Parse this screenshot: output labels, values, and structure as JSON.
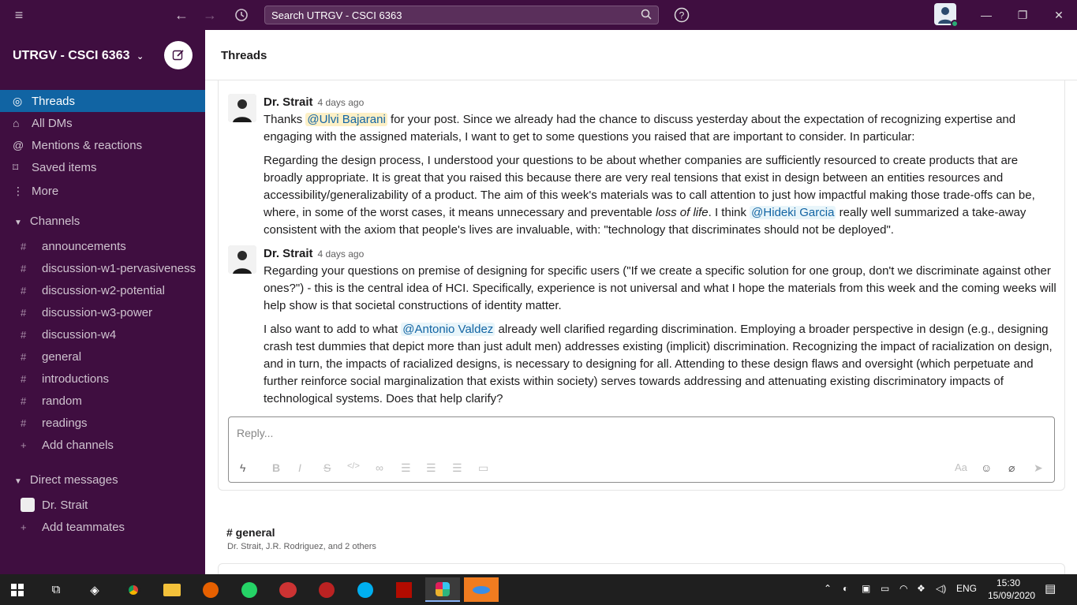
{
  "topbar": {
    "search_placeholder": "Search UTRGV - CSCI 6363",
    "icons": [
      "hamburger-icon",
      "back-icon",
      "forward-icon",
      "history-icon",
      "search-icon",
      "help-icon"
    ]
  },
  "workspace": {
    "name": "UTRGV - CSCI 6363"
  },
  "nav": [
    {
      "label": "Threads",
      "icon": "threads-icon",
      "active": true
    },
    {
      "label": "All DMs",
      "icon": "dms-icon"
    },
    {
      "label": "Mentions & reactions",
      "icon": "at-icon"
    },
    {
      "label": "Saved items",
      "icon": "bookmark-icon"
    },
    {
      "label": "More",
      "icon": "more-icon"
    }
  ],
  "channels_label": "Channels",
  "channels": [
    "announcements",
    "discussion-w1-pervasiveness",
    "discussion-w2-potential",
    "discussion-w3-power",
    "discussion-w4",
    "general",
    "introductions",
    "random",
    "readings"
  ],
  "add_channels": "Add channels",
  "dm_label": "Direct messages",
  "dms": [
    "Dr. Strait"
  ],
  "add_teammates": "Add teammates",
  "header": {
    "title": "Threads"
  },
  "messages": [
    {
      "author": "Dr. Strait",
      "time": "4 days ago",
      "p1_a": "Thanks ",
      "p1_mention": "@Ulvi Bajarani",
      "p1_b": " for your post. Since we already had the chance to discuss yesterday about the expectation of recognizing expertise and engaging with the assigned materials, I want to get to some questions you raised that are important to consider. In particular:",
      "p2_a": "Regarding the design process, I understood your questions to be about whether companies are sufficiently resourced to create products that are broadly appropriate. It is great that you raised this because there are very real tensions that exist in design between an entities resources and accessibility/generalizability of a product. The aim of this week's materials was to call attention to just how impactful making those trade-offs can be, where, in some of the worst cases, it means unnecessary and preventable ",
      "p2_em": "loss of life",
      "p2_b": ". I think ",
      "p2_mention": "@Hideki Garcia",
      "p2_c": " really well summarized a take-away consistent with the axiom that people's lives are invaluable, with: \"technology that discriminates should not be deployed\"."
    },
    {
      "author": "Dr. Strait",
      "time": "4 days ago",
      "p1": "Regarding your questions on premise of designing for specific users (\"If we create a specific solution for one group, don't we discriminate against other ones?\") - this is the central idea of HCI. Specifically, experience is not universal and what I hope the materials from this week and the coming weeks will help show is that societal constructions of identity matter.",
      "p2_a": "I also want to add to what ",
      "p2_mention": "@Antonio Valdez",
      "p2_b": " already well clarified regarding discrimination. Employing a broader perspective in design (e.g., designing crash test dummies that depict more than just adult men) addresses existing (implicit) discrimination. Recognizing the impact of racialization on design, and in turn, the impacts of racialized designs, is necessary to designing for all. Attending to these design flaws and oversight (which perpetuate and further reinforce social marginalization that exists within society) serves towards addressing and attenuating existing discriminatory impacts of technological systems. Does that help clarify?"
    }
  ],
  "reply": {
    "placeholder": "Reply..."
  },
  "next_thread": {
    "channel": "# general",
    "participants": "Dr. Strait, J.R. Rodriguez, and 2 others"
  },
  "taskbar": {
    "lang": "ENG",
    "time": "15:30",
    "date": "15/09/2020"
  }
}
